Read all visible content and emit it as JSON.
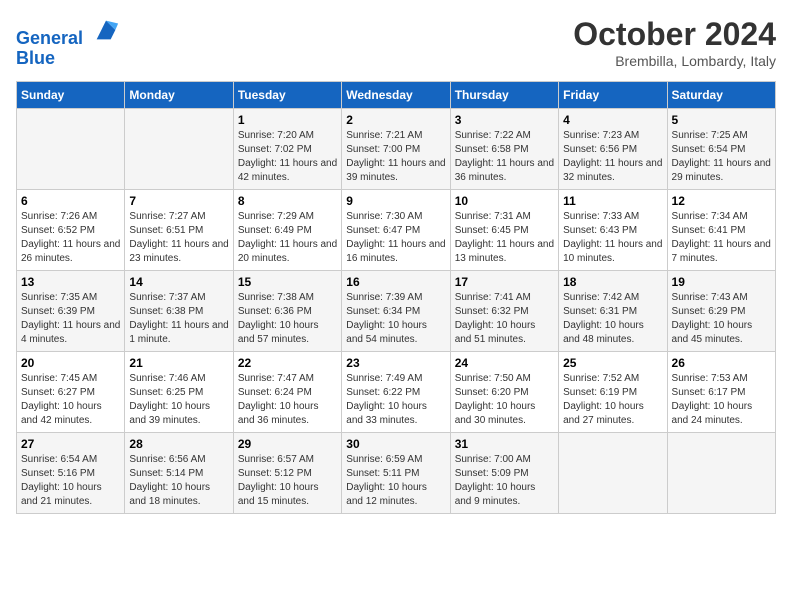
{
  "header": {
    "logo_line1": "General",
    "logo_line2": "Blue",
    "month_title": "October 2024",
    "location": "Brembilla, Lombardy, Italy"
  },
  "days_of_week": [
    "Sunday",
    "Monday",
    "Tuesday",
    "Wednesday",
    "Thursday",
    "Friday",
    "Saturday"
  ],
  "weeks": [
    [
      {
        "day": "",
        "sunrise": "",
        "sunset": "",
        "daylight": ""
      },
      {
        "day": "",
        "sunrise": "",
        "sunset": "",
        "daylight": ""
      },
      {
        "day": "1",
        "sunrise": "Sunrise: 7:20 AM",
        "sunset": "Sunset: 7:02 PM",
        "daylight": "Daylight: 11 hours and 42 minutes."
      },
      {
        "day": "2",
        "sunrise": "Sunrise: 7:21 AM",
        "sunset": "Sunset: 7:00 PM",
        "daylight": "Daylight: 11 hours and 39 minutes."
      },
      {
        "day": "3",
        "sunrise": "Sunrise: 7:22 AM",
        "sunset": "Sunset: 6:58 PM",
        "daylight": "Daylight: 11 hours and 36 minutes."
      },
      {
        "day": "4",
        "sunrise": "Sunrise: 7:23 AM",
        "sunset": "Sunset: 6:56 PM",
        "daylight": "Daylight: 11 hours and 32 minutes."
      },
      {
        "day": "5",
        "sunrise": "Sunrise: 7:25 AM",
        "sunset": "Sunset: 6:54 PM",
        "daylight": "Daylight: 11 hours and 29 minutes."
      }
    ],
    [
      {
        "day": "6",
        "sunrise": "Sunrise: 7:26 AM",
        "sunset": "Sunset: 6:52 PM",
        "daylight": "Daylight: 11 hours and 26 minutes."
      },
      {
        "day": "7",
        "sunrise": "Sunrise: 7:27 AM",
        "sunset": "Sunset: 6:51 PM",
        "daylight": "Daylight: 11 hours and 23 minutes."
      },
      {
        "day": "8",
        "sunrise": "Sunrise: 7:29 AM",
        "sunset": "Sunset: 6:49 PM",
        "daylight": "Daylight: 11 hours and 20 minutes."
      },
      {
        "day": "9",
        "sunrise": "Sunrise: 7:30 AM",
        "sunset": "Sunset: 6:47 PM",
        "daylight": "Daylight: 11 hours and 16 minutes."
      },
      {
        "day": "10",
        "sunrise": "Sunrise: 7:31 AM",
        "sunset": "Sunset: 6:45 PM",
        "daylight": "Daylight: 11 hours and 13 minutes."
      },
      {
        "day": "11",
        "sunrise": "Sunrise: 7:33 AM",
        "sunset": "Sunset: 6:43 PM",
        "daylight": "Daylight: 11 hours and 10 minutes."
      },
      {
        "day": "12",
        "sunrise": "Sunrise: 7:34 AM",
        "sunset": "Sunset: 6:41 PM",
        "daylight": "Daylight: 11 hours and 7 minutes."
      }
    ],
    [
      {
        "day": "13",
        "sunrise": "Sunrise: 7:35 AM",
        "sunset": "Sunset: 6:39 PM",
        "daylight": "Daylight: 11 hours and 4 minutes."
      },
      {
        "day": "14",
        "sunrise": "Sunrise: 7:37 AM",
        "sunset": "Sunset: 6:38 PM",
        "daylight": "Daylight: 11 hours and 1 minute."
      },
      {
        "day": "15",
        "sunrise": "Sunrise: 7:38 AM",
        "sunset": "Sunset: 6:36 PM",
        "daylight": "Daylight: 10 hours and 57 minutes."
      },
      {
        "day": "16",
        "sunrise": "Sunrise: 7:39 AM",
        "sunset": "Sunset: 6:34 PM",
        "daylight": "Daylight: 10 hours and 54 minutes."
      },
      {
        "day": "17",
        "sunrise": "Sunrise: 7:41 AM",
        "sunset": "Sunset: 6:32 PM",
        "daylight": "Daylight: 10 hours and 51 minutes."
      },
      {
        "day": "18",
        "sunrise": "Sunrise: 7:42 AM",
        "sunset": "Sunset: 6:31 PM",
        "daylight": "Daylight: 10 hours and 48 minutes."
      },
      {
        "day": "19",
        "sunrise": "Sunrise: 7:43 AM",
        "sunset": "Sunset: 6:29 PM",
        "daylight": "Daylight: 10 hours and 45 minutes."
      }
    ],
    [
      {
        "day": "20",
        "sunrise": "Sunrise: 7:45 AM",
        "sunset": "Sunset: 6:27 PM",
        "daylight": "Daylight: 10 hours and 42 minutes."
      },
      {
        "day": "21",
        "sunrise": "Sunrise: 7:46 AM",
        "sunset": "Sunset: 6:25 PM",
        "daylight": "Daylight: 10 hours and 39 minutes."
      },
      {
        "day": "22",
        "sunrise": "Sunrise: 7:47 AM",
        "sunset": "Sunset: 6:24 PM",
        "daylight": "Daylight: 10 hours and 36 minutes."
      },
      {
        "day": "23",
        "sunrise": "Sunrise: 7:49 AM",
        "sunset": "Sunset: 6:22 PM",
        "daylight": "Daylight: 10 hours and 33 minutes."
      },
      {
        "day": "24",
        "sunrise": "Sunrise: 7:50 AM",
        "sunset": "Sunset: 6:20 PM",
        "daylight": "Daylight: 10 hours and 30 minutes."
      },
      {
        "day": "25",
        "sunrise": "Sunrise: 7:52 AM",
        "sunset": "Sunset: 6:19 PM",
        "daylight": "Daylight: 10 hours and 27 minutes."
      },
      {
        "day": "26",
        "sunrise": "Sunrise: 7:53 AM",
        "sunset": "Sunset: 6:17 PM",
        "daylight": "Daylight: 10 hours and 24 minutes."
      }
    ],
    [
      {
        "day": "27",
        "sunrise": "Sunrise: 6:54 AM",
        "sunset": "Sunset: 5:16 PM",
        "daylight": "Daylight: 10 hours and 21 minutes."
      },
      {
        "day": "28",
        "sunrise": "Sunrise: 6:56 AM",
        "sunset": "Sunset: 5:14 PM",
        "daylight": "Daylight: 10 hours and 18 minutes."
      },
      {
        "day": "29",
        "sunrise": "Sunrise: 6:57 AM",
        "sunset": "Sunset: 5:12 PM",
        "daylight": "Daylight: 10 hours and 15 minutes."
      },
      {
        "day": "30",
        "sunrise": "Sunrise: 6:59 AM",
        "sunset": "Sunset: 5:11 PM",
        "daylight": "Daylight: 10 hours and 12 minutes."
      },
      {
        "day": "31",
        "sunrise": "Sunrise: 7:00 AM",
        "sunset": "Sunset: 5:09 PM",
        "daylight": "Daylight: 10 hours and 9 minutes."
      },
      {
        "day": "",
        "sunrise": "",
        "sunset": "",
        "daylight": ""
      },
      {
        "day": "",
        "sunrise": "",
        "sunset": "",
        "daylight": ""
      }
    ]
  ]
}
